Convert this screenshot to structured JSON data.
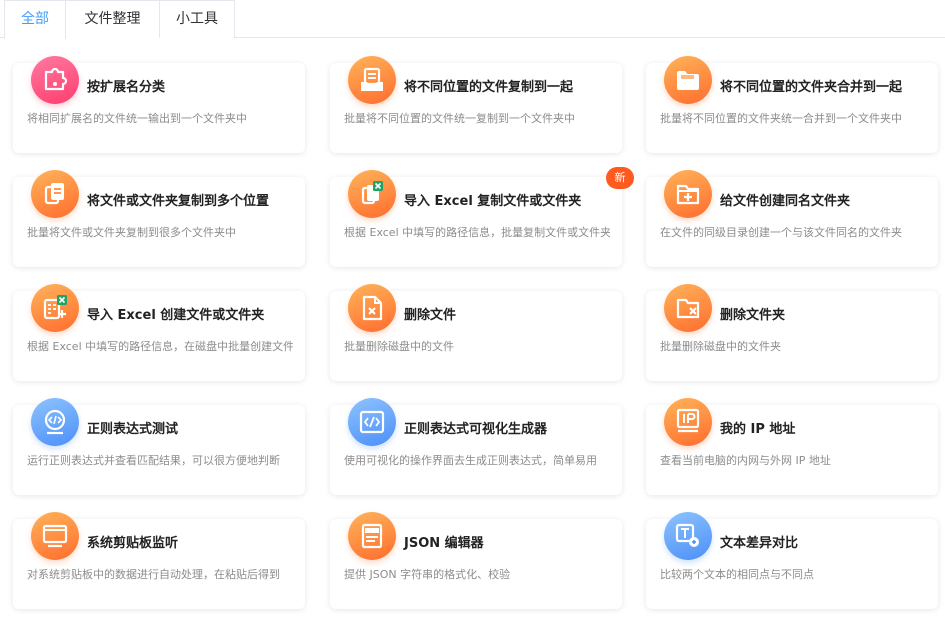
{
  "tabs": [
    {
      "label": "全部",
      "active": true
    },
    {
      "label": "文件整理",
      "active": false
    },
    {
      "label": "小工具",
      "active": false
    }
  ],
  "colors": {
    "accent": "#409eff",
    "badge": "#ff5a1f",
    "orange": "#ff6d2e",
    "pink": "#ff3d6e",
    "blue": "#4d8ff7"
  },
  "cards": [
    {
      "title": "按扩展名分类",
      "desc": "将相同扩展名的文件统一输出到一个文件夹中",
      "icon": "puzzle-icon"
    },
    {
      "title": "将不同位置的文件复制到一起",
      "desc": "批量将不同位置的文件统一复制到一个文件夹中",
      "icon": "inbox-document-icon"
    },
    {
      "title": "将不同位置的文件夹合并到一起",
      "desc": "批量将不同位置的文件夹统一合并到一个文件夹中",
      "icon": "folder-icon"
    },
    {
      "title": "将文件或文件夹复制到多个位置",
      "desc": "批量将文件或文件夹复制到很多个文件夹中",
      "icon": "copy-documents-icon"
    },
    {
      "title": "导入 Excel 复制文件或文件夹",
      "desc": "根据 Excel 中填写的路径信息，批量复制文件或文件夹",
      "icon": "excel-copy-icon",
      "badge": "新"
    },
    {
      "title": "给文件创建同名文件夹",
      "desc": "在文件的同级目录创建一个与该文件同名的文件夹",
      "icon": "folder-plus-icon"
    },
    {
      "title": "导入 Excel 创建文件或文件夹",
      "desc": "根据 Excel 中填写的路径信息，在磁盘中批量创建文件或文件夹",
      "icon": "excel-create-icon"
    },
    {
      "title": "删除文件",
      "desc": "批量删除磁盘中的文件",
      "icon": "file-delete-icon"
    },
    {
      "title": "删除文件夹",
      "desc": "批量删除磁盘中的文件夹",
      "icon": "folder-delete-icon"
    },
    {
      "title": "正则表达式测试",
      "desc": "运行正则表达式并查看匹配结果，可以很方便地判断",
      "icon": "code-circle-icon"
    },
    {
      "title": "正则表达式可视化生成器",
      "desc": "使用可视化的操作界面去生成正则表达式，简单易用",
      "icon": "code-window-icon"
    },
    {
      "title": "我的 IP 地址",
      "desc": "查看当前电脑的内网与外网 IP 地址",
      "icon": "ip-icon"
    },
    {
      "title": "系统剪贴板监听",
      "desc": "对系统剪贴板中的数据进行自动处理，在粘贴后得到",
      "icon": "monitor-icon"
    },
    {
      "title": "JSON 编辑器",
      "desc": "提供 JSON 字符串的格式化、校验",
      "icon": "json-file-icon"
    },
    {
      "title": "文本差异对比",
      "desc": "比较两个文本的相同点与不同点",
      "icon": "text-compare-icon"
    }
  ]
}
